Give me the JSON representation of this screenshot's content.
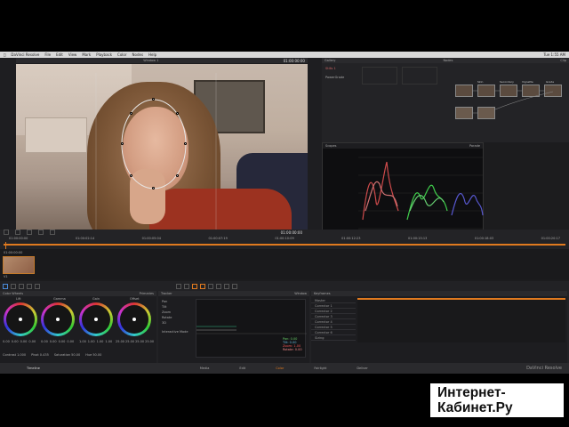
{
  "menubar": {
    "app": "DaVinci Resolve",
    "items": [
      "File",
      "Edit",
      "View",
      "Mark",
      "Playback",
      "Color",
      "Nodes",
      "Help"
    ],
    "status": "Tue 1:55 AM"
  },
  "viewer": {
    "title": "Window 1",
    "timecode": "01:00:00:00",
    "play_timecode": "01:00:00:00"
  },
  "gallery": {
    "title": "Gallery",
    "items": [
      "Stills 1",
      "PowerGrade"
    ]
  },
  "nodes": {
    "title": "Nodes",
    "mode": "Clip",
    "labels": [
      "01",
      "Skin",
      "Secondary",
      "Vignette",
      "Grade",
      "Output"
    ]
  },
  "scopes": {
    "title": "Scopes",
    "mode": "Parade"
  },
  "timeline": {
    "tick_labels": [
      "01:00:00:00",
      "01:00:02:14",
      "01:00:05:04",
      "01:00:07:19",
      "01:00:10:09",
      "01:00:12:23",
      "01:00:15:13",
      "01:00:18:03",
      "01:00:20:17"
    ],
    "clip_timecode": "01:00:00:00",
    "clip_label": "V1"
  },
  "color_wheels": {
    "title": "Color Wheels",
    "wheels": [
      {
        "name": "Lift",
        "values": [
          "0.00",
          "0.00",
          "0.00",
          "0.00"
        ]
      },
      {
        "name": "Gamma",
        "values": [
          "0.00",
          "0.00",
          "0.00",
          "0.00"
        ]
      },
      {
        "name": "Gain",
        "values": [
          "1.00",
          "1.00",
          "1.00",
          "1.00"
        ]
      },
      {
        "name": "Offset",
        "values": [
          "25.00",
          "25.00",
          "25.00",
          "25.00"
        ]
      }
    ],
    "primaries_label": "Primaries",
    "footer": [
      "Contrast 1.000",
      "Pivot 0.435",
      "Saturation 50.00",
      "Hue 50.00",
      "Lum Mix 100.00"
    ]
  },
  "tracker": {
    "title": "Tracker",
    "options": [
      "Pan",
      "Tilt",
      "Zoom",
      "Rotate",
      "3D"
    ],
    "analysis": "Interactive Mode",
    "window_label": "Window",
    "readouts": [
      "Pan: 0.00",
      "Tilt: 0.00",
      "Zoom: 1.00",
      "Rotate: 0.00"
    ]
  },
  "keyframes": {
    "title": "Keyframes",
    "rows": [
      "Master",
      "Corrector 1",
      "Corrector 2",
      "Corrector 3",
      "Corrector 4",
      "Corrector 5",
      "Corrector 6",
      "Sizing"
    ]
  },
  "pages": {
    "items": [
      "Media",
      "Edit",
      "Color",
      "Fairlight",
      "Deliver"
    ],
    "brand": "DaVinci Resolve",
    "project": "Timeline"
  },
  "watermark": {
    "line1": "Интернет-",
    "line2": "Кабинет.Ру"
  }
}
